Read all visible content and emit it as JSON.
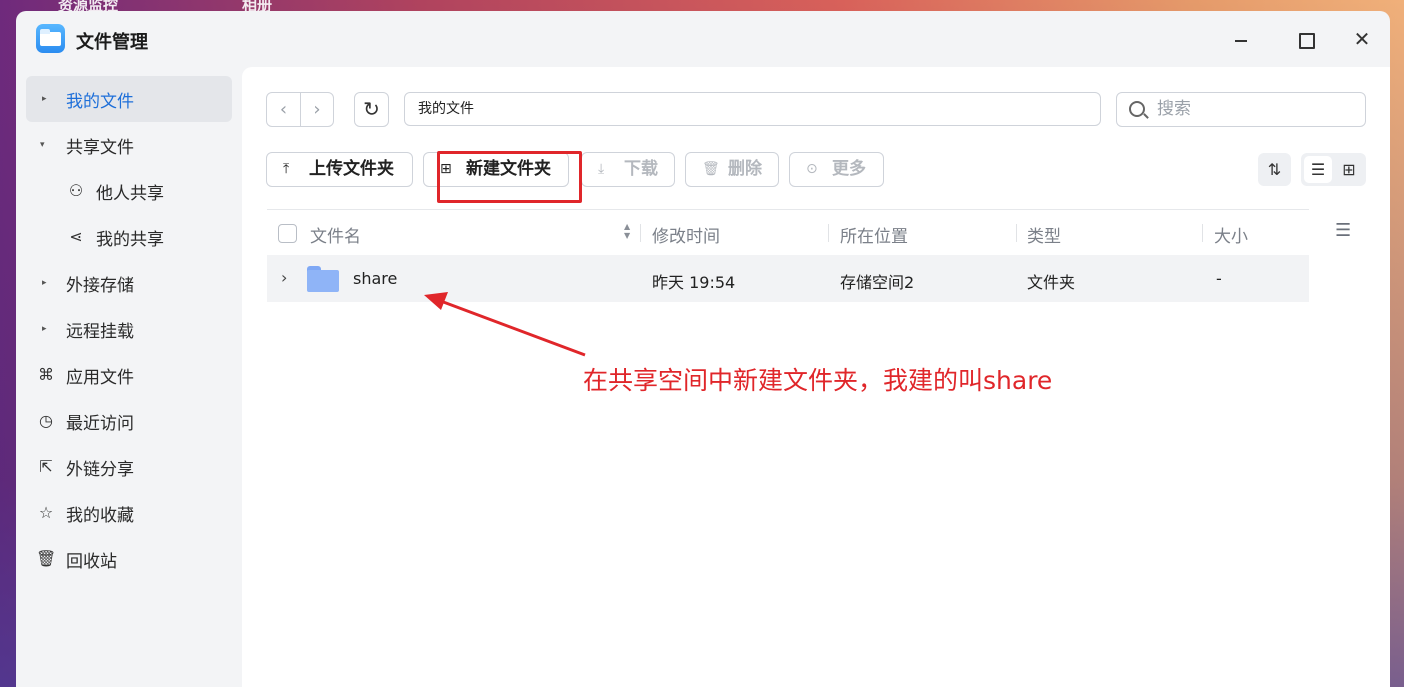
{
  "desktop": {
    "labels": [
      "资源监控",
      "相册"
    ]
  },
  "window": {
    "title": "文件管理",
    "close_glyph": "✕"
  },
  "sidebar": {
    "items": [
      {
        "label": "我的文件",
        "arrow": "▸",
        "active": true
      },
      {
        "label": "共享文件",
        "arrow": "▾"
      },
      {
        "label": "他人共享",
        "icon": "people-icon",
        "glyph": "⚇"
      },
      {
        "label": "我的共享",
        "icon": "share-icon",
        "glyph": "⋖"
      },
      {
        "label": "外接存储",
        "arrow": "▸"
      },
      {
        "label": "远程挂载",
        "arrow": "▸"
      },
      {
        "label": "应用文件",
        "icon": "apps-icon",
        "glyph": "⌘"
      },
      {
        "label": "最近访问",
        "icon": "clock-icon",
        "glyph": "◷"
      },
      {
        "label": "外链分享",
        "icon": "external-share-icon",
        "glyph": "⇱"
      },
      {
        "label": "我的收藏",
        "icon": "star-icon",
        "glyph": "☆"
      },
      {
        "label": "回收站",
        "icon": "trash-icon",
        "glyph": "🗑"
      }
    ]
  },
  "nav": {
    "back": "‹",
    "forward": "›",
    "refresh": "↻"
  },
  "path": {
    "value": "我的文件"
  },
  "search": {
    "placeholder": "搜索"
  },
  "toolbar": {
    "upload": {
      "label": "上传文件夹",
      "glyph": "⤒"
    },
    "new_folder": {
      "label": "新建文件夹",
      "glyph": "⊞"
    },
    "download": {
      "label": "下载",
      "glyph": "⤓"
    },
    "delete": {
      "label": "删除",
      "glyph": "🗑"
    },
    "more": {
      "label": "更多",
      "glyph": "⊙"
    },
    "sort_glyph": "⇅",
    "view_list_glyph": "☰",
    "view_grid_glyph": "⊞"
  },
  "table": {
    "columns": [
      "文件名",
      "修改时间",
      "所在位置",
      "类型",
      "大小"
    ],
    "sort_glyph": "▲\n▼",
    "settings_glyph": "☰",
    "rows": [
      {
        "expand": "›",
        "name": "share",
        "modified": "昨天 19:54",
        "location": "存储空间2",
        "type": "文件夹",
        "size": "-"
      }
    ]
  },
  "annotation": {
    "text": "在共享空间中新建文件夹，我建的叫share",
    "color": "#e0262a"
  },
  "colors": {
    "accent": "#1e6fd9",
    "annotation_red": "#e0262a",
    "folder": "#8fb4f7"
  }
}
